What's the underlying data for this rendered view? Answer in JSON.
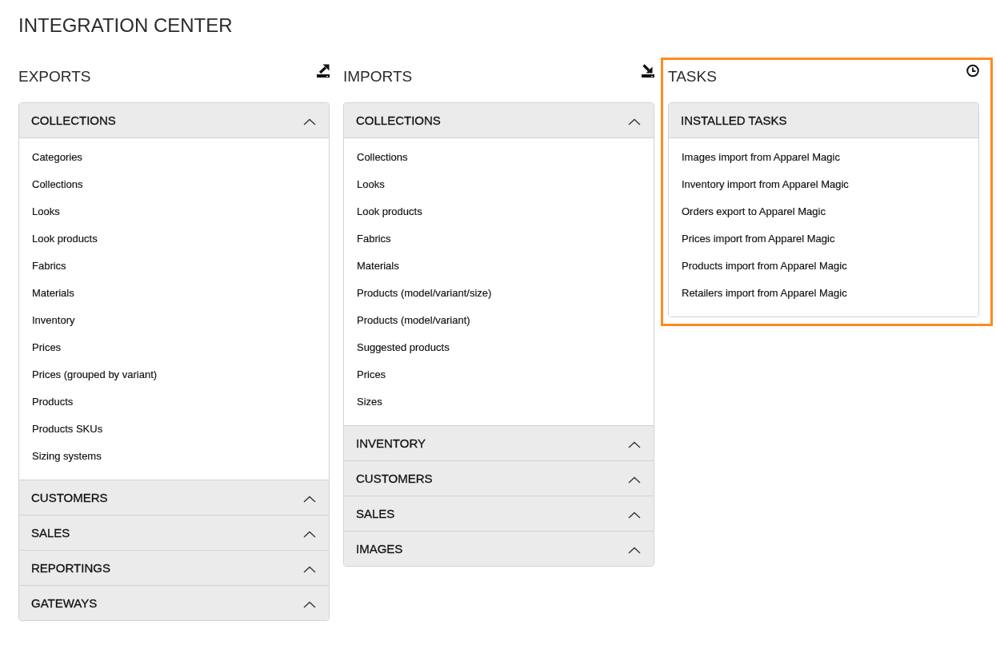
{
  "page": {
    "title": "INTEGRATION CENTER"
  },
  "columns": [
    {
      "kind": "exports",
      "heading": "EXPORTS",
      "highlighted": false,
      "sections": [
        {
          "title": "COLLECTIONS",
          "items": [
            "Categories",
            "Collections",
            "Looks",
            "Look products",
            "Fabrics",
            "Materials",
            "Inventory",
            "Prices",
            "Prices (grouped by variant)",
            "Products",
            "Products SKUs",
            "Sizing systems"
          ]
        },
        {
          "title": "CUSTOMERS"
        },
        {
          "title": "SALES"
        },
        {
          "title": "REPORTINGS"
        },
        {
          "title": "GATEWAYS"
        }
      ]
    },
    {
      "kind": "imports",
      "heading": "IMPORTS",
      "highlighted": false,
      "sections": [
        {
          "title": "COLLECTIONS",
          "items": [
            "Collections",
            "Looks",
            "Look products",
            "Fabrics",
            "Materials",
            "Products (model/variant/size)",
            "Products (model/variant)",
            "Suggested products",
            "Prices",
            "Sizes"
          ]
        },
        {
          "title": "INVENTORY"
        },
        {
          "title": "CUSTOMERS"
        },
        {
          "title": "SALES"
        },
        {
          "title": "IMAGES"
        }
      ]
    },
    {
      "kind": "tasks",
      "heading": "TASKS",
      "highlighted": true,
      "sections": [
        {
          "title": "INSTALLED TASKS",
          "items": [
            "Images import from Apparel Magic",
            "Inventory import from Apparel Magic",
            "Orders export to Apparel Magic",
            "Prices import from Apparel Magic",
            "Products import from Apparel Magic",
            "Retailers import from Apparel Magic"
          ]
        }
      ]
    }
  ]
}
